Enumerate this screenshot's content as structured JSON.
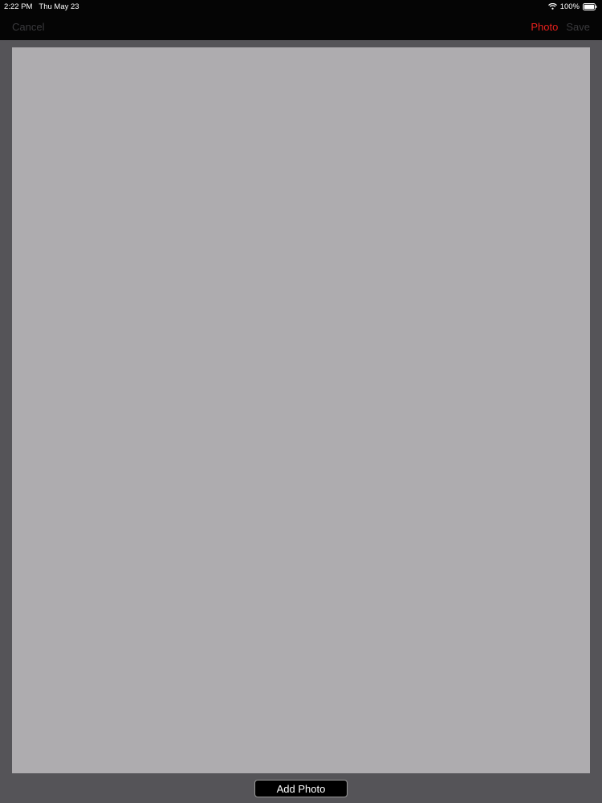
{
  "status_bar": {
    "time": "2:22 PM",
    "date": "Thu May 23",
    "battery": "100%",
    "icons": [
      "wifi-icon",
      "battery-icon"
    ]
  },
  "nav_bar": {
    "cancel_label": "Cancel",
    "photo_label": "Photo",
    "save_label": "Save"
  },
  "canvas": {},
  "bottom_bar": {
    "add_photo_label": "Add Photo"
  },
  "colors": {
    "accent": "#e8211d",
    "canvas": "#aeacaf",
    "background": "#555458",
    "bars": "#050505",
    "disabled_text": "#3a3a3d"
  }
}
